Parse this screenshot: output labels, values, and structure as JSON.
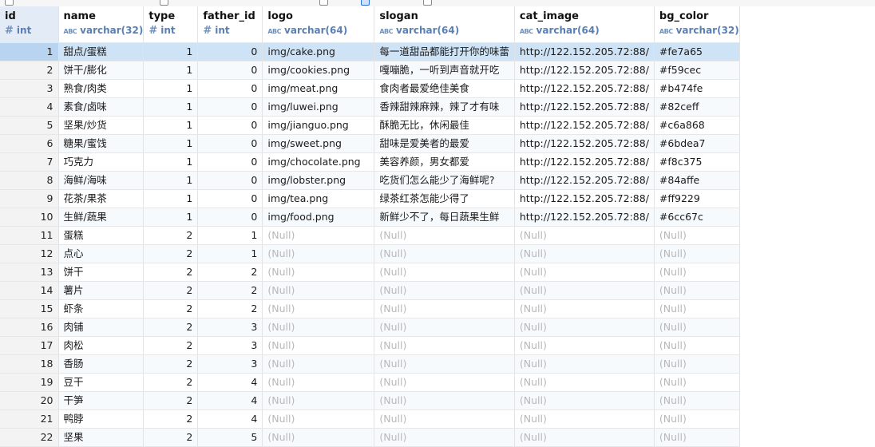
{
  "columns": [
    {
      "name": "id",
      "type": "int",
      "kind": "number"
    },
    {
      "name": "name",
      "type": "varchar(32)",
      "kind": "text"
    },
    {
      "name": "type",
      "type": "int",
      "kind": "number"
    },
    {
      "name": "father_id",
      "type": "int",
      "kind": "number"
    },
    {
      "name": "logo",
      "type": "varchar(64)",
      "kind": "text"
    },
    {
      "name": "slogan",
      "type": "varchar(64)",
      "kind": "text"
    },
    {
      "name": "cat_image",
      "type": "varchar(64)",
      "kind": "text"
    },
    {
      "name": "bg_color",
      "type": "varchar(32)",
      "kind": "text"
    }
  ],
  "selected_row_index": 0,
  "rows": [
    {
      "id": "1",
      "name": "甜点/蛋糕",
      "type": "1",
      "father_id": "0",
      "logo": "img/cake.png",
      "slogan": "每一道甜品都能打开你的味蕾",
      "cat_image": "http://122.152.205.72:88/",
      "bg_color": "#fe7a65"
    },
    {
      "id": "2",
      "name": "饼干/膨化",
      "type": "1",
      "father_id": "0",
      "logo": "img/cookies.png",
      "slogan": "嘎嘣脆，一听到声音就开吃",
      "cat_image": "http://122.152.205.72:88/",
      "bg_color": "#f59cec"
    },
    {
      "id": "3",
      "name": "熟食/肉类",
      "type": "1",
      "father_id": "0",
      "logo": "img/meat.png",
      "slogan": "食肉者最爱绝佳美食",
      "cat_image": "http://122.152.205.72:88/",
      "bg_color": "#b474fe"
    },
    {
      "id": "4",
      "name": "素食/卤味",
      "type": "1",
      "father_id": "0",
      "logo": "img/luwei.png",
      "slogan": "香辣甜辣麻辣，辣了才有味",
      "cat_image": "http://122.152.205.72:88/",
      "bg_color": "#82ceff"
    },
    {
      "id": "5",
      "name": "坚果/炒货",
      "type": "1",
      "father_id": "0",
      "logo": "img/jianguo.png",
      "slogan": "酥脆无比，休闲最佳",
      "cat_image": "http://122.152.205.72:88/",
      "bg_color": "#c6a868"
    },
    {
      "id": "6",
      "name": "糖果/蜜饯",
      "type": "1",
      "father_id": "0",
      "logo": "img/sweet.png",
      "slogan": "甜味是爱美者的最爱",
      "cat_image": "http://122.152.205.72:88/",
      "bg_color": "#6bdea7"
    },
    {
      "id": "7",
      "name": "巧克力",
      "type": "1",
      "father_id": "0",
      "logo": "img/chocolate.png",
      "slogan": "美容养颜，男女都爱",
      "cat_image": "http://122.152.205.72:88/",
      "bg_color": "#f8c375"
    },
    {
      "id": "8",
      "name": "海鲜/海味",
      "type": "1",
      "father_id": "0",
      "logo": "img/lobster.png",
      "slogan": "吃货们怎么能少了海鲜呢?",
      "cat_image": "http://122.152.205.72:88/",
      "bg_color": "#84affe"
    },
    {
      "id": "9",
      "name": "花茶/果茶",
      "type": "1",
      "father_id": "0",
      "logo": "img/tea.png",
      "slogan": "绿茶红茶怎能少得了",
      "cat_image": "http://122.152.205.72:88/",
      "bg_color": "#ff9229"
    },
    {
      "id": "10",
      "name": "生鲜/蔬果",
      "type": "1",
      "father_id": "0",
      "logo": "img/food.png",
      "slogan": "新鲜少不了，每日蔬果生鲜",
      "cat_image": "http://122.152.205.72:88/",
      "bg_color": "#6cc67c"
    },
    {
      "id": "11",
      "name": "蛋糕",
      "type": "2",
      "father_id": "1",
      "logo": "(Null)",
      "slogan": "(Null)",
      "cat_image": "(Null)",
      "bg_color": "(Null)"
    },
    {
      "id": "12",
      "name": "点心",
      "type": "2",
      "father_id": "1",
      "logo": "(Null)",
      "slogan": "(Null)",
      "cat_image": "(Null)",
      "bg_color": "(Null)"
    },
    {
      "id": "13",
      "name": "饼干",
      "type": "2",
      "father_id": "2",
      "logo": "(Null)",
      "slogan": "(Null)",
      "cat_image": "(Null)",
      "bg_color": "(Null)"
    },
    {
      "id": "14",
      "name": "薯片",
      "type": "2",
      "father_id": "2",
      "logo": "(Null)",
      "slogan": "(Null)",
      "cat_image": "(Null)",
      "bg_color": "(Null)"
    },
    {
      "id": "15",
      "name": "虾条",
      "type": "2",
      "father_id": "2",
      "logo": "(Null)",
      "slogan": "(Null)",
      "cat_image": "(Null)",
      "bg_color": "(Null)"
    },
    {
      "id": "16",
      "name": "肉铺",
      "type": "2",
      "father_id": "3",
      "logo": "(Null)",
      "slogan": "(Null)",
      "cat_image": "(Null)",
      "bg_color": "(Null)"
    },
    {
      "id": "17",
      "name": "肉松",
      "type": "2",
      "father_id": "3",
      "logo": "(Null)",
      "slogan": "(Null)",
      "cat_image": "(Null)",
      "bg_color": "(Null)"
    },
    {
      "id": "18",
      "name": "香肠",
      "type": "2",
      "father_id": "3",
      "logo": "(Null)",
      "slogan": "(Null)",
      "cat_image": "(Null)",
      "bg_color": "(Null)"
    },
    {
      "id": "19",
      "name": "豆干",
      "type": "2",
      "father_id": "4",
      "logo": "(Null)",
      "slogan": "(Null)",
      "cat_image": "(Null)",
      "bg_color": "(Null)"
    },
    {
      "id": "20",
      "name": "干笋",
      "type": "2",
      "father_id": "4",
      "logo": "(Null)",
      "slogan": "(Null)",
      "cat_image": "(Null)",
      "bg_color": "(Null)"
    },
    {
      "id": "21",
      "name": "鸭脖",
      "type": "2",
      "father_id": "4",
      "logo": "(Null)",
      "slogan": "(Null)",
      "cat_image": "(Null)",
      "bg_color": "(Null)"
    },
    {
      "id": "22",
      "name": "坚果",
      "type": "2",
      "father_id": "5",
      "logo": "(Null)",
      "slogan": "(Null)",
      "cat_image": "(Null)",
      "bg_color": "(Null)"
    }
  ],
  "colors": {
    "selected_row": "#cfe3f7",
    "id_header": "#e2ebf6",
    "null_text": "#b8b8b8",
    "type_text": "#5a7fb3"
  }
}
